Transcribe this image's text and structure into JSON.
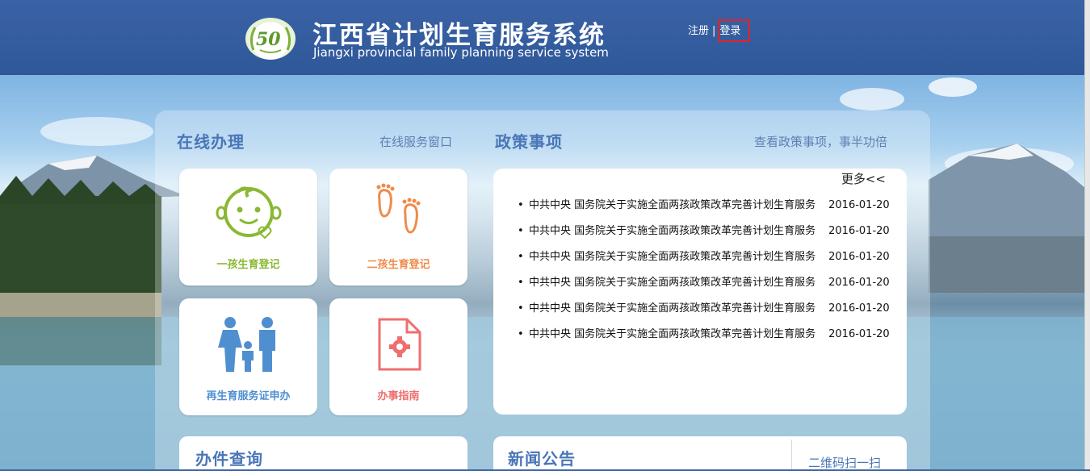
{
  "header": {
    "title_cn": "江西省计划生育服务系统",
    "title_en": "Jiangxi provincial family planning service system",
    "register": "注册",
    "separator": "|",
    "login": "登录",
    "login_highlight_color": "#e0242a",
    "bg_color": "#3a62a6"
  },
  "online": {
    "title": "在线办理",
    "link": "在线服务窗口",
    "cards": [
      {
        "label": "一孩生育登记",
        "icon": "baby-face-icon",
        "color": "#8ab833"
      },
      {
        "label": "二孩生育登记",
        "icon": "footprints-icon",
        "color": "#ef8b4a"
      },
      {
        "label": "再生育服务证申办",
        "icon": "family-icon",
        "color": "#4f8fd0"
      },
      {
        "label": "办事指南",
        "icon": "document-gear-icon",
        "color": "#ee6f6f"
      }
    ]
  },
  "policy": {
    "title": "政策事项",
    "link": "查看政策事项，事半功倍",
    "more": "更多<<",
    "items": [
      {
        "text": "中共中央 国务院关于实施全面两孩政策改革完善计划生育服务",
        "date": "2016-01-20"
      },
      {
        "text": "中共中央 国务院关于实施全面两孩政策改革完善计划生育服务",
        "date": "2016-01-20"
      },
      {
        "text": "中共中央 国务院关于实施全面两孩政策改革完善计划生育服务",
        "date": "2016-01-20"
      },
      {
        "text": "中共中央 国务院关于实施全面两孩政策改革完善计划生育服务",
        "date": "2016-01-20"
      },
      {
        "text": "中共中央 国务院关于实施全面两孩政策改革完善计划生育服务",
        "date": "2016-01-20"
      },
      {
        "text": "中共中央 国务院关于实施全面两孩政策改革完善计划生育服务",
        "date": "2016-01-20"
      }
    ]
  },
  "bottom": {
    "query_title": "办件查询",
    "news_title": "新闻公告",
    "qr_link": "二维码扫一扫"
  }
}
